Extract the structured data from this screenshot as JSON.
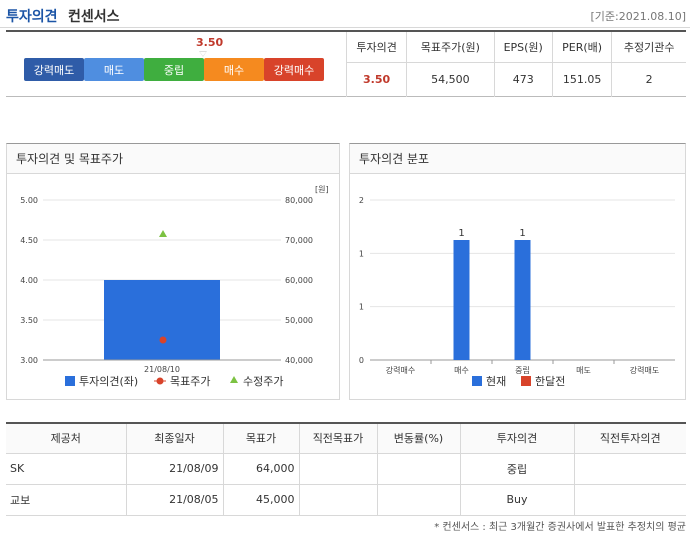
{
  "header": {
    "title_blue": "투자의견",
    "title_black": "컨센서스",
    "date": "[기준:2021.08.10]"
  },
  "summary": {
    "score": "3.50",
    "scale": [
      {
        "label": "강력매도",
        "color": "#2f5ca8"
      },
      {
        "label": "매도",
        "color": "#4f8ee0"
      },
      {
        "label": "중립",
        "color": "#3fae3f"
      },
      {
        "label": "매수",
        "color": "#f58a1f"
      },
      {
        "label": "강력매수",
        "color": "#d8432a"
      }
    ],
    "headers": [
      "투자의견",
      "목표주가(원)",
      "EPS(원)",
      "PER(배)",
      "추정기관수"
    ],
    "values": [
      "3.50",
      "54,500",
      "473",
      "151.05",
      "2"
    ]
  },
  "panel1": {
    "title": "투자의견 및 목표주가"
  },
  "panel2": {
    "title": "투자의견 분포"
  },
  "chart_data": [
    {
      "type": "bar",
      "title": "투자의견 및 목표주가",
      "categories": [
        "21/08/10"
      ],
      "y_left_ticks": [
        "5.00",
        "4.50",
        "4.00",
        "3.50",
        "3.00"
      ],
      "y_left_range": [
        3.0,
        5.0
      ],
      "y_right_unit": "[원]",
      "y_right_ticks": [
        "80,000",
        "70,000",
        "60,000",
        "50,000",
        "40,000"
      ],
      "y_right_range": [
        40000,
        80000
      ],
      "series": [
        {
          "name": "투자의견(좌)",
          "values": [
            4.0
          ],
          "color": "#2a6fdb"
        },
        {
          "name": "목표주가",
          "values": [
            45000
          ],
          "color": "#d8432a"
        },
        {
          "name": "수정주가",
          "values": [
            71500
          ],
          "color": "#7cc242"
        }
      ]
    },
    {
      "type": "bar",
      "title": "투자의견 분포",
      "categories": [
        "강력매수",
        "매수",
        "중립",
        "매도",
        "강력매도"
      ],
      "y_ticks": [
        "2",
        "1",
        "1",
        "0"
      ],
      "y_range": [
        0,
        2
      ],
      "series": [
        {
          "name": "현재",
          "values": [
            0,
            1,
            1,
            0,
            0
          ],
          "color": "#2a6fdb"
        },
        {
          "name": "한달전",
          "values": [
            0,
            0,
            0,
            0,
            0
          ],
          "color": "#d8432a"
        }
      ]
    }
  ],
  "table": {
    "headers": [
      "제공처",
      "최종일자",
      "목표가",
      "직전목표가",
      "변동률(%)",
      "투자의견",
      "직전투자의견"
    ],
    "rows": [
      [
        "SK",
        "21/08/09",
        "64,000",
        "",
        "",
        "중립",
        ""
      ],
      [
        "교보",
        "21/08/05",
        "45,000",
        "",
        "",
        "Buy",
        ""
      ]
    ]
  },
  "note": "* 컨센서스 : 최근 3개월간 증권사에서 발표한 추정치의 평균"
}
